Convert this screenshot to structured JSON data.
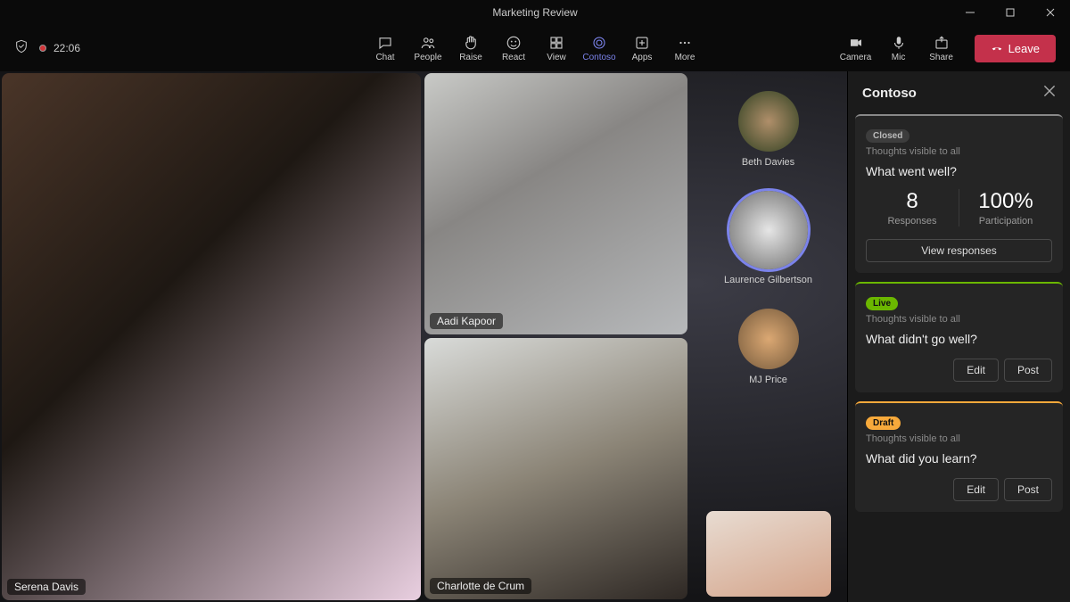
{
  "title": "Marketing Review",
  "timer": "22:06",
  "toolbar": {
    "chat_label": "Chat",
    "people_label": "People",
    "raise_label": "Raise",
    "react_label": "React",
    "view_label": "View",
    "contoso_label": "Contoso",
    "apps_label": "Apps",
    "more_label": "More",
    "camera_label": "Camera",
    "mic_label": "Mic",
    "share_label": "Share",
    "leave_label": "Leave"
  },
  "participants": {
    "tile1": "Serena Davis",
    "tile2": "Aadi Kapoor",
    "tile3": "Charlotte de Crum",
    "avatar1": "Beth Davies",
    "avatar2": "Laurence Gilbertson",
    "avatar3": "MJ Price"
  },
  "panel": {
    "title": "Contoso",
    "visibility_text": "Thoughts visible to all",
    "card1": {
      "badge": "Closed",
      "question": "What went well?",
      "responses_val": "8",
      "responses_lbl": "Responses",
      "participation_val": "100%",
      "participation_lbl": "Participation",
      "view_btn": "View responses"
    },
    "card2": {
      "badge": "Live",
      "question": "What didn't go well?",
      "edit_btn": "Edit",
      "post_btn": "Post"
    },
    "card3": {
      "badge": "Draft",
      "question": "What did you learn?",
      "edit_btn": "Edit",
      "post_btn": "Post"
    }
  }
}
